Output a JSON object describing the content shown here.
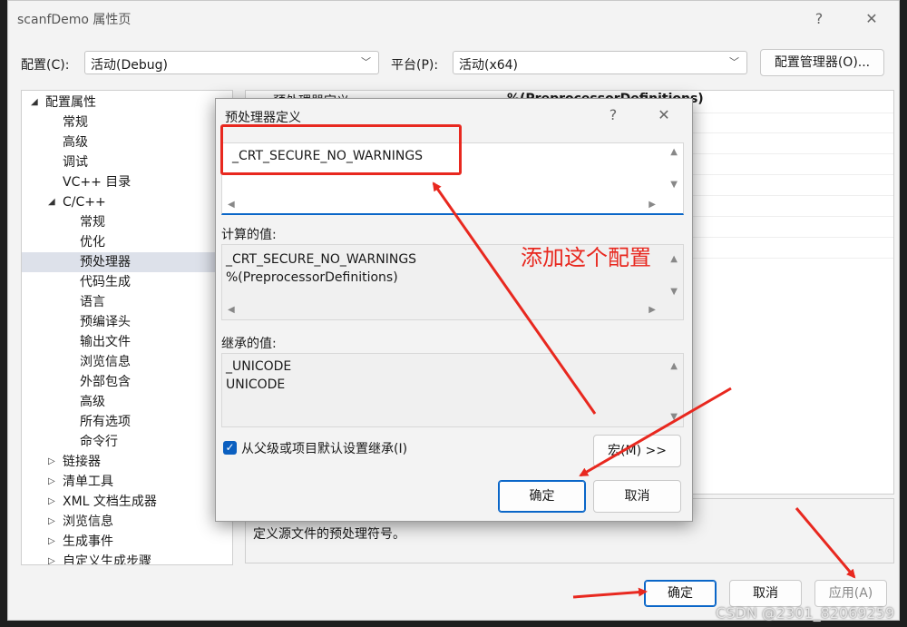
{
  "window": {
    "title": "scanfDemo 属性页",
    "help": "?",
    "close": "✕"
  },
  "toolbar": {
    "config_label": "配置(C):",
    "config_value": "活动(Debug)",
    "platform_label": "平台(P):",
    "platform_value": "活动(x64)",
    "config_manager": "配置管理器(O)..."
  },
  "tree": [
    {
      "label": "配置属性",
      "twisty": "◢"
    },
    {
      "label": "常规"
    },
    {
      "label": "高级"
    },
    {
      "label": "调试"
    },
    {
      "label": "VC++ 目录"
    },
    {
      "label": "C/C++",
      "twisty": "◢"
    },
    {
      "label": "常规"
    },
    {
      "label": "优化"
    },
    {
      "label": "预处理器"
    },
    {
      "label": "代码生成"
    },
    {
      "label": "语言"
    },
    {
      "label": "预编译头"
    },
    {
      "label": "输出文件"
    },
    {
      "label": "浏览信息"
    },
    {
      "label": "外部包含"
    },
    {
      "label": "高级"
    },
    {
      "label": "所有选项"
    },
    {
      "label": "命令行"
    },
    {
      "label": "链接器",
      "twisty": "▷"
    },
    {
      "label": "清单工具",
      "twisty": "▷"
    },
    {
      "label": "XML 文档生成器",
      "twisty": "▷"
    },
    {
      "label": "浏览信息",
      "twisty": "▷"
    },
    {
      "label": "生成事件",
      "twisty": "▷"
    },
    {
      "label": "自定义生成步骤",
      "twisty": "▷"
    }
  ],
  "grid": {
    "row0_name": "预处理器定义",
    "row0_value": "%(PreprocessorDefinitions)"
  },
  "description": "定义源文件的预处理符号。",
  "footer": {
    "ok": "确定",
    "cancel": "取消",
    "apply": "应用(A)"
  },
  "dialog": {
    "title": "预处理器定义",
    "help": "?",
    "close": "✕",
    "input_value": "_CRT_SECURE_NO_WARNINGS",
    "evaluated_label": "计算的值:",
    "evaluated_lines": [
      "_CRT_SECURE_NO_WARNINGS",
      "%(PreprocessorDefinitions)"
    ],
    "inherited_label": "继承的值:",
    "inherited_lines": [
      "_UNICODE",
      "UNICODE"
    ],
    "inherit_checkbox": "从父级或项目默认设置继承(I)",
    "inherit_checked": true,
    "macros_button": "宏(M) >>",
    "ok": "确定",
    "cancel": "取消"
  },
  "annotation": {
    "text": "添加这个配置",
    "color": "#e8281f"
  },
  "watermark": "CSDN @2301_82069259",
  "colors": {
    "accent": "#0a66c8",
    "selection": "#dde1ea",
    "annotation_red": "#e8281f"
  }
}
